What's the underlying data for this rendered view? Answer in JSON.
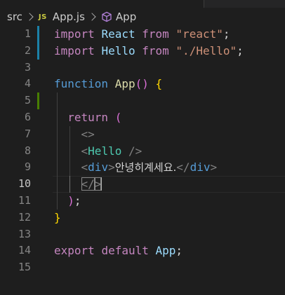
{
  "breadcrumb": {
    "folder": "src",
    "file_badge": "JS",
    "file": "App.js",
    "symbol": "App"
  },
  "lines": [
    {
      "num": "1",
      "diff": "mod",
      "tokens": [
        {
          "t": "import",
          "c": "kw-purple"
        },
        {
          "t": " ",
          "c": "punct"
        },
        {
          "t": "React",
          "c": "ident"
        },
        {
          "t": " ",
          "c": "punct"
        },
        {
          "t": "from",
          "c": "kw-purple"
        },
        {
          "t": " ",
          "c": "punct"
        },
        {
          "t": "\"react\"",
          "c": "str"
        },
        {
          "t": ";",
          "c": "punct"
        }
      ]
    },
    {
      "num": "2",
      "diff": "mod",
      "tokens": [
        {
          "t": "import",
          "c": "kw-purple"
        },
        {
          "t": " ",
          "c": "punct"
        },
        {
          "t": "Hello",
          "c": "ident"
        },
        {
          "t": " ",
          "c": "punct"
        },
        {
          "t": "from",
          "c": "kw-purple"
        },
        {
          "t": " ",
          "c": "punct"
        },
        {
          "t": "\"./Hello\"",
          "c": "str"
        },
        {
          "t": ";",
          "c": "punct"
        }
      ]
    },
    {
      "num": "3",
      "tokens": []
    },
    {
      "num": "4",
      "tokens": [
        {
          "t": "function",
          "c": "kw-blue"
        },
        {
          "t": " ",
          "c": "punct"
        },
        {
          "t": "App",
          "c": "fn"
        },
        {
          "t": "()",
          "c": "paren-purple"
        },
        {
          "t": " ",
          "c": "punct"
        },
        {
          "t": "{",
          "c": "brace"
        }
      ]
    },
    {
      "num": "5",
      "diff": "add",
      "guides": [
        1
      ],
      "tokens": []
    },
    {
      "num": "6",
      "guides": [
        1
      ],
      "tokens": [
        {
          "t": "  ",
          "c": "punct"
        },
        {
          "t": "return",
          "c": "kw-purple"
        },
        {
          "t": " ",
          "c": "punct"
        },
        {
          "t": "(",
          "c": "paren-purple"
        }
      ]
    },
    {
      "num": "7",
      "guides": [
        1,
        2
      ],
      "tokens": [
        {
          "t": "    ",
          "c": "punct"
        },
        {
          "t": "<>",
          "c": "tag-bracket"
        }
      ]
    },
    {
      "num": "8",
      "guides": [
        1,
        2
      ],
      "tokens": [
        {
          "t": "    ",
          "c": "punct"
        },
        {
          "t": "<",
          "c": "tag-bracket"
        },
        {
          "t": "Hello",
          "c": "tag-comp"
        },
        {
          "t": " ",
          "c": "punct"
        },
        {
          "t": "/>",
          "c": "tag-bracket"
        }
      ]
    },
    {
      "num": "9",
      "guides": [
        1,
        2
      ],
      "tokens": [
        {
          "t": "    ",
          "c": "punct"
        },
        {
          "t": "<",
          "c": "tag-bracket"
        },
        {
          "t": "div",
          "c": "tag-html"
        },
        {
          "t": ">",
          "c": "tag-bracket"
        },
        {
          "t": "안녕히계세요.",
          "c": "kr-text"
        },
        {
          "t": "</",
          "c": "tag-bracket"
        },
        {
          "t": "div",
          "c": "tag-html"
        },
        {
          "t": ">",
          "c": "tag-bracket"
        }
      ]
    },
    {
      "num": "10",
      "current": true,
      "guides": [
        1,
        2
      ],
      "tokens": [
        {
          "t": "    ",
          "c": "punct"
        },
        {
          "t": "</",
          "c": "tag-bracket",
          "match": true
        },
        {
          "t": ">",
          "c": "tag-bracket",
          "match": true,
          "cursor": true
        }
      ]
    },
    {
      "num": "11",
      "guides": [
        1
      ],
      "tokens": [
        {
          "t": "  ",
          "c": "punct"
        },
        {
          "t": ")",
          "c": "paren-purple"
        },
        {
          "t": ";",
          "c": "punct"
        }
      ]
    },
    {
      "num": "12",
      "tokens": [
        {
          "t": "}",
          "c": "brace"
        }
      ]
    },
    {
      "num": "13",
      "tokens": []
    },
    {
      "num": "14",
      "tokens": [
        {
          "t": "export",
          "c": "kw-purple"
        },
        {
          "t": " ",
          "c": "punct"
        },
        {
          "t": "default",
          "c": "kw-purple"
        },
        {
          "t": " ",
          "c": "punct"
        },
        {
          "t": "App",
          "c": "ident"
        },
        {
          "t": ";",
          "c": "punct"
        }
      ]
    },
    {
      "num": "15",
      "tokens": []
    }
  ]
}
